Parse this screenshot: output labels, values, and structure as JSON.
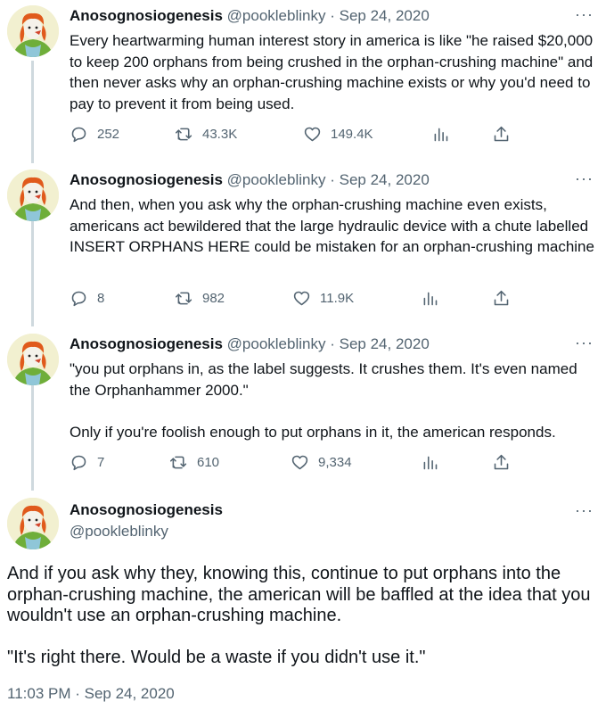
{
  "author": {
    "name": "Anosognosiogenesis",
    "handle": "@pookleblinky"
  },
  "tweets": [
    {
      "sep": "·",
      "date": "Sep 24, 2020",
      "text": "Every heartwarming human interest story in america is like \"he raised $20,000 to keep 200 orphans from being crushed in the orphan-crushing machine\" and then never asks why an orphan-crushing machine exists or why you'd need to pay to prevent it from being used.",
      "replies": "252",
      "retweets": "43.3K",
      "likes": "149.4K"
    },
    {
      "sep": "·",
      "date": "Sep 24, 2020",
      "text": "And then, when you ask why the orphan-crushing machine even exists, americans act bewildered that the large hydraulic device with a chute labelled INSERT ORPHANS HERE could be mistaken for an orphan-crushing machine",
      "replies": "8",
      "retweets": "982",
      "likes": "11.9K"
    },
    {
      "sep": "·",
      "date": "Sep 24, 2020",
      "text": "\"you put orphans in, as the label suggests. It crushes them. It's even named the Orphanhammer 2000.\"\n\nOnly if you're foolish enough to put orphans in it, the american responds.",
      "replies": "7",
      "retweets": "610",
      "likes": "9,334"
    }
  ],
  "main": {
    "paragraph1": "And if you ask why they, knowing this, continue to put orphans into the orphan-crushing machine, the american will be baffled at the idea that you wouldn't use an orphan-crushing machine.",
    "paragraph2": "\"It's right there. Would be a waste if you didn't use it.\"",
    "timestamp": "11:03 PM · Sep 24, 2020"
  },
  "icons": {
    "more": "more-horizontal-icon",
    "reply": "reply-icon",
    "retweet": "retweet-icon",
    "like": "heart-icon",
    "views": "analytics-icon",
    "share": "share-icon"
  },
  "colors": {
    "text": "#0f1419",
    "secondary": "#536471",
    "thread_line": "#cfd9de",
    "avatar_bg": "#f2f0d0"
  },
  "more_glyph": "···"
}
